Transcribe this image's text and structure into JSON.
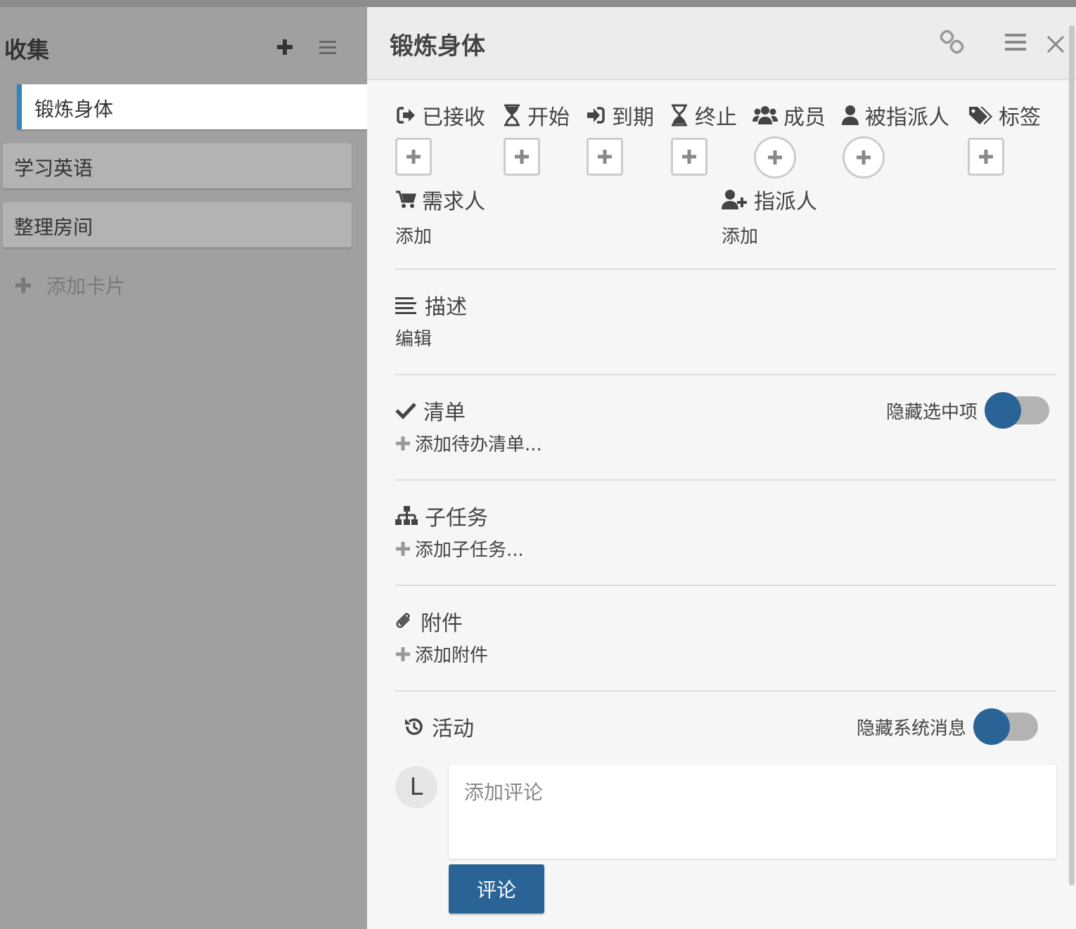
{
  "list": {
    "title": "收集",
    "cards": [
      {
        "label": "锻炼身体"
      },
      {
        "label": "学习英语"
      },
      {
        "label": "整理房间"
      }
    ],
    "add_card_label": "添加卡片"
  },
  "details": {
    "title": "锻炼身体",
    "badges": [
      {
        "label": "已接收",
        "icon": "sign-in-icon"
      },
      {
        "label": "开始",
        "icon": "hourglass-start-icon"
      },
      {
        "label": "到期",
        "icon": "arrow-in-icon"
      },
      {
        "label": "终止",
        "icon": "hourglass-end-icon"
      },
      {
        "label": "成员",
        "icon": "users-icon"
      },
      {
        "label": "被指派人",
        "icon": "user-icon"
      },
      {
        "label": "标签",
        "icon": "tags-icon"
      }
    ],
    "requester": {
      "label": "需求人",
      "add": "添加"
    },
    "assigner": {
      "label": "指派人",
      "add": "添加"
    },
    "description": {
      "label": "描述",
      "edit": "编辑"
    },
    "checklist": {
      "label": "清单",
      "add": "添加待办清单...",
      "hide_checked": "隐藏选中项"
    },
    "subtasks": {
      "label": "子任务",
      "add": "添加子任务..."
    },
    "attachments": {
      "label": "附件",
      "add": "添加附件"
    },
    "activity": {
      "label": "活动",
      "hide_system": "隐藏系统消息"
    },
    "comment": {
      "avatar_initial": "L",
      "placeholder": "添加评论",
      "submit": "评论"
    }
  },
  "colors": {
    "accent": "#2a6496",
    "active_card_border": "#2e86c1"
  }
}
